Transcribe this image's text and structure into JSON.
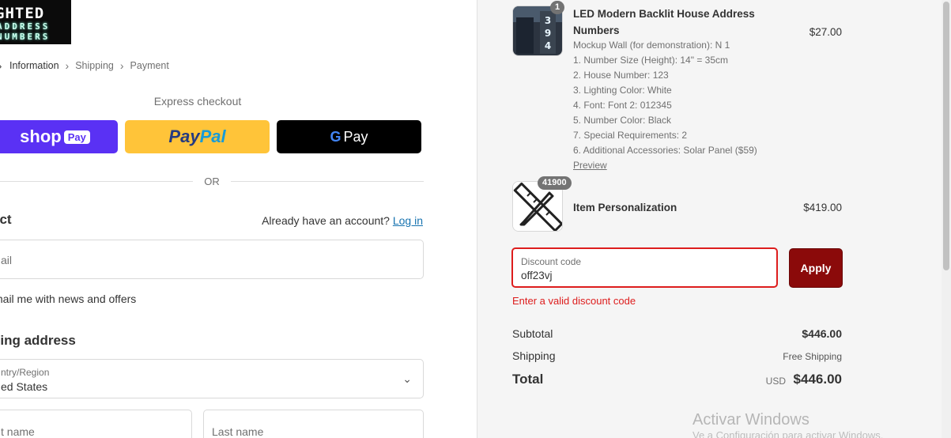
{
  "logo": {
    "line1": "GHTED",
    "line2": "ADDRESS",
    "line3": "NUMBERS"
  },
  "breadcrumb": {
    "information": "Information",
    "shipping": "Shipping",
    "payment": "Payment"
  },
  "express": {
    "title": "Express checkout",
    "shop_pay": "shop",
    "shop_pay_badge": "Pay",
    "paypal_1": "Pay",
    "paypal_2": "Pal",
    "gpay_g": "G",
    "gpay": "Pay",
    "or": "OR"
  },
  "contact": {
    "title": "act",
    "already": "Already have an account?",
    "login": "Log in",
    "email_placeholder": "ail",
    "news": "mail me with news and offers"
  },
  "shipping_address": {
    "title": "ping address",
    "country_label": "ntry/Region",
    "country_value": "ed States",
    "first_name": "t name",
    "last_name": "Last name"
  },
  "summary": {
    "items": [
      {
        "qty": "1",
        "title_1": "LED Modern Backlit House Address",
        "title_2": "Numbers",
        "price": "$27.00",
        "options": [
          "Mockup Wall (for demonstration): N 1",
          "1. Number Size (Height): 14\" = 35cm",
          "2. House Number: 123",
          "3. Lighting Color: White",
          "4. Font: Font 2: 012345",
          "5. Number Color: Black",
          "7. Special Requirements: 2",
          "6. Additional Accessories: Solar Panel ($59)"
        ],
        "preview": "Preview"
      },
      {
        "qty": "41900",
        "title": "Item Personalization",
        "price": "$419.00"
      }
    ],
    "discount": {
      "label": "Discount code",
      "value": "off23vj",
      "apply": "Apply",
      "error": "Enter a valid discount code"
    },
    "subtotal_label": "Subtotal",
    "subtotal": "$446.00",
    "shipping_label": "Shipping",
    "shipping": "Free Shipping",
    "total_label": "Total",
    "currency": "USD",
    "total": "$446.00"
  },
  "watermark": {
    "line1": "Activar Windows",
    "line2": "Ve a Configuración para activar Windows."
  },
  "colors": {
    "accent": "#8b0a0a",
    "error": "#dd1d1d",
    "shop_pay": "#5a31f4",
    "paypal": "#ffc439",
    "link": "#1773b0"
  }
}
